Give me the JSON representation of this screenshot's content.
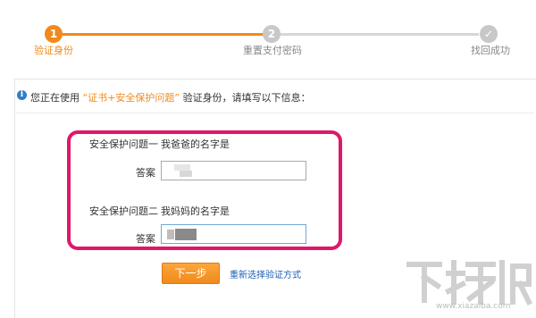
{
  "steps": [
    {
      "num": "1",
      "label": "验证身份",
      "state": "active"
    },
    {
      "num": "2",
      "label": "重置支付密码",
      "state": "todo"
    },
    {
      "num": "✓",
      "label": "找回成功",
      "state": "todo"
    }
  ],
  "notice": {
    "prefix": "您正在使用 ",
    "method": "“证书+安全保护问题”",
    "suffix": " 验证身份，请填写以下信息："
  },
  "questions": [
    {
      "label": "安全保护问题一",
      "question": "我爸爸的名字是",
      "answer_label": "答案"
    },
    {
      "label": "安全保护问题二",
      "question": "我妈妈的名字是",
      "answer_label": "答案"
    }
  ],
  "actions": {
    "next_label": "下一步",
    "reselect_label": "重新选择验证方式"
  },
  "watermark": {
    "logo": "下载吧",
    "url": "www.xiazaiba.com"
  },
  "colors": {
    "accent": "#f08a1c",
    "highlight": "#e0176a",
    "link": "#1a5fb4"
  }
}
